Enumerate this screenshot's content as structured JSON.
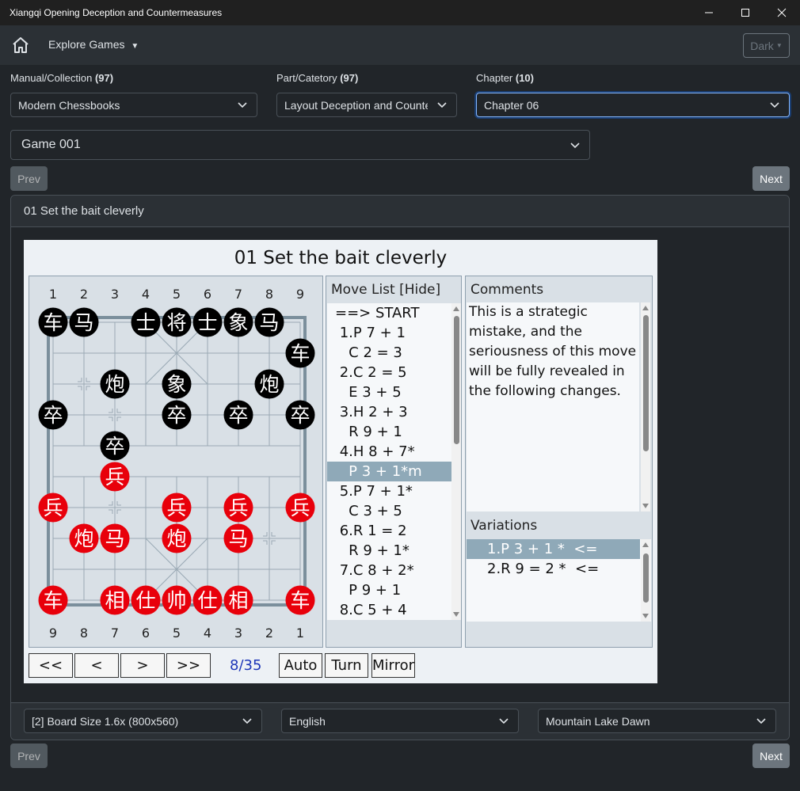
{
  "window": {
    "title": "Xiangqi Opening Deception and Countermeasures",
    "controls": [
      "minimize",
      "maximize",
      "close"
    ]
  },
  "navbar": {
    "explore_label": "Explore Games",
    "theme_label": "Dark"
  },
  "filters": {
    "manual": {
      "label": "Manual/Collection",
      "count": "(97)",
      "value": "Modern Chessbooks"
    },
    "part": {
      "label": "Part/Catetory",
      "count": "(97)",
      "value": "Layout Deception and Counte"
    },
    "chapter": {
      "label": "Chapter",
      "count": "(10)",
      "value": "Chapter 06"
    },
    "game": {
      "value": "Game 001"
    }
  },
  "nav": {
    "prev": "Prev",
    "next": "Next"
  },
  "card": {
    "header": "01 Set the bait cleverly"
  },
  "viewer": {
    "title": "01 Set the bait cleverly",
    "top_files": [
      "1",
      "2",
      "3",
      "4",
      "5",
      "6",
      "7",
      "8",
      "9"
    ],
    "bottom_files": [
      "9",
      "8",
      "7",
      "6",
      "5",
      "4",
      "3",
      "2",
      "1"
    ],
    "black_pieces": [
      {
        "ch": "车",
        "c": 0,
        "r": 0
      },
      {
        "ch": "马",
        "c": 1,
        "r": 0
      },
      {
        "ch": "士",
        "c": 3,
        "r": 0
      },
      {
        "ch": "将",
        "c": 4,
        "r": 0
      },
      {
        "ch": "士",
        "c": 5,
        "r": 0
      },
      {
        "ch": "象",
        "c": 6,
        "r": 0
      },
      {
        "ch": "马",
        "c": 7,
        "r": 0
      },
      {
        "ch": "车",
        "c": 8,
        "r": 1
      },
      {
        "ch": "炮",
        "c": 2,
        "r": 2
      },
      {
        "ch": "象",
        "c": 4,
        "r": 2
      },
      {
        "ch": "炮",
        "c": 7,
        "r": 2
      },
      {
        "ch": "卒",
        "c": 0,
        "r": 3
      },
      {
        "ch": "卒",
        "c": 4,
        "r": 3
      },
      {
        "ch": "卒",
        "c": 6,
        "r": 3
      },
      {
        "ch": "卒",
        "c": 8,
        "r": 3
      },
      {
        "ch": "卒",
        "c": 2,
        "r": 4
      }
    ],
    "red_pieces": [
      {
        "ch": "兵",
        "c": 2,
        "r": 5
      },
      {
        "ch": "兵",
        "c": 0,
        "r": 6
      },
      {
        "ch": "兵",
        "c": 4,
        "r": 6
      },
      {
        "ch": "兵",
        "c": 6,
        "r": 6
      },
      {
        "ch": "兵",
        "c": 8,
        "r": 6
      },
      {
        "ch": "炮",
        "c": 1,
        "r": 7
      },
      {
        "ch": "马",
        "c": 2,
        "r": 7
      },
      {
        "ch": "炮",
        "c": 4,
        "r": 7
      },
      {
        "ch": "马",
        "c": 6,
        "r": 7
      },
      {
        "ch": "车",
        "c": 0,
        "r": 9
      },
      {
        "ch": "相",
        "c": 2,
        "r": 9
      },
      {
        "ch": "仕",
        "c": 3,
        "r": 9
      },
      {
        "ch": "帅",
        "c": 4,
        "r": 9
      },
      {
        "ch": "仕",
        "c": 5,
        "r": 9
      },
      {
        "ch": "相",
        "c": 6,
        "r": 9
      },
      {
        "ch": "车",
        "c": 8,
        "r": 9
      }
    ],
    "move_list_title": "Move List [Hide]",
    "moves": [
      "==> START",
      " 1.P 7 + 1",
      "   C 2 = 3",
      " 2.C 2 = 5",
      "   E 3 + 5",
      " 3.H 2 + 3",
      "   R 9 + 1",
      " 4.H 8 + 7*",
      "   P 3 + 1*m",
      " 5.P 7 + 1*",
      "   C 3 + 5",
      " 6.R 1 = 2",
      "   R 9 + 1*",
      " 7.C 8 + 2*",
      "   P 9 + 1",
      " 8.C 5 + 4"
    ],
    "current_move_index": 8,
    "comments_title": "Comments",
    "comment_text": "This is a strategic mistake, and the seriousness of this move will be fully revealed in the following changes.",
    "variations_title": "Variations",
    "variations": [
      "1.P 3 + 1 *  <=",
      "2.R 9 = 2 *  <="
    ],
    "controls": {
      "first": "<<",
      "prev": "<",
      "next": ">",
      "last": ">>",
      "counter": "8/35",
      "auto": "Auto",
      "turn": "Turn",
      "mirror": "Mirror"
    }
  },
  "footer": {
    "board_size": "[2] Board Size 1.6x (800x560)",
    "language": "English",
    "theme": "Mountain Lake Dawn"
  },
  "colors": {
    "black_piece": "#000000",
    "red_piece": "#e8000b",
    "selection": "#8fa9b8",
    "focus": "#86b7fe"
  }
}
